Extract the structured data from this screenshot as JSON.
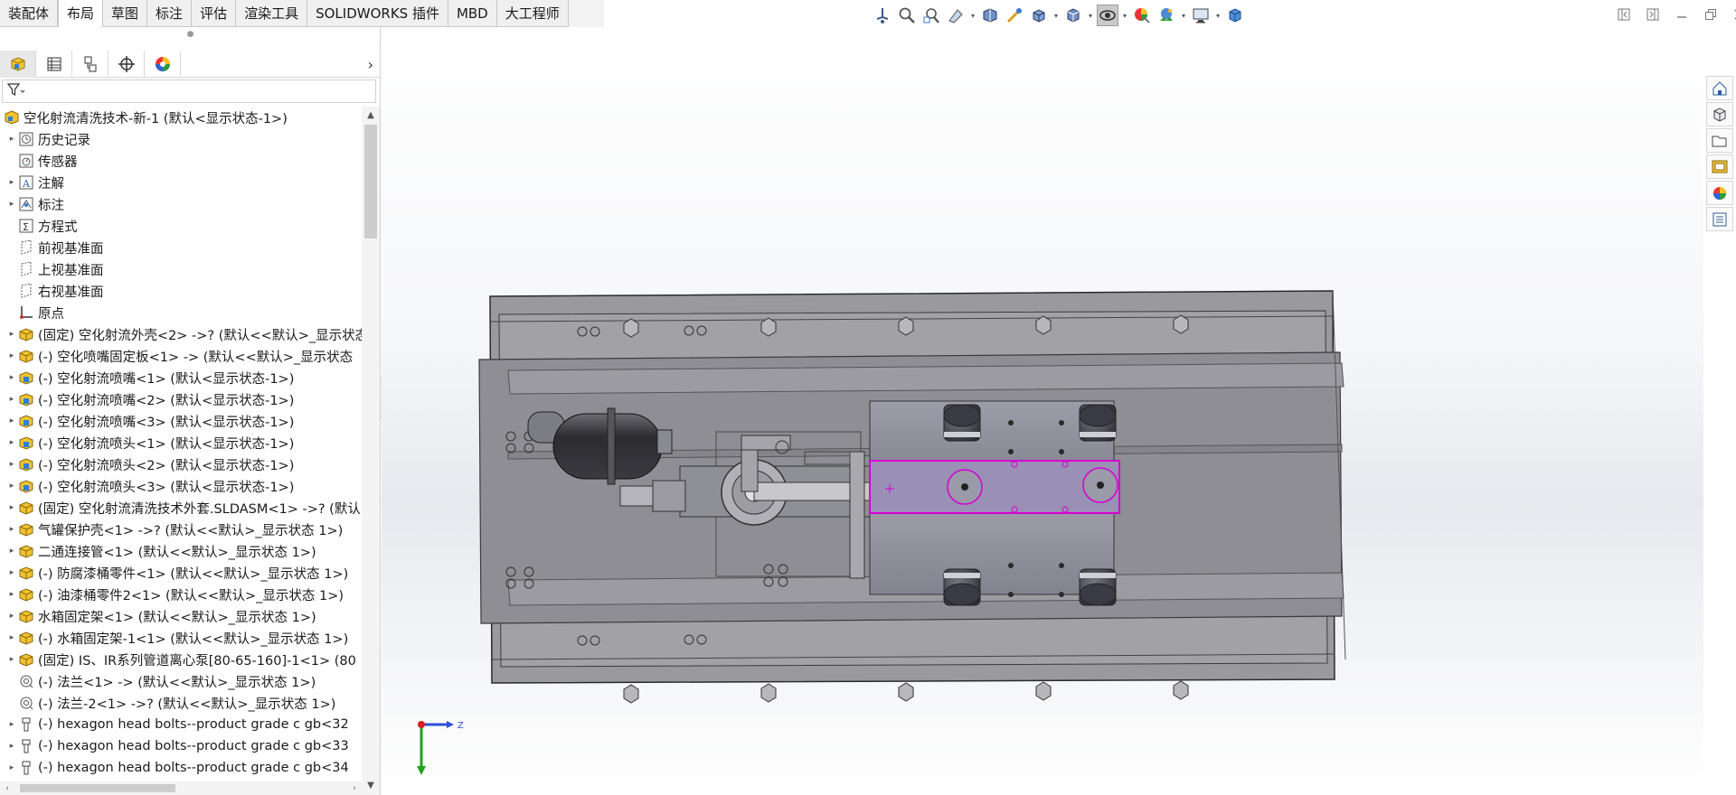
{
  "tabs": [
    {
      "label": "装配体",
      "active": false
    },
    {
      "label": "布局",
      "active": true
    },
    {
      "label": "草图",
      "active": false
    },
    {
      "label": "标注",
      "active": false
    },
    {
      "label": "评估",
      "active": false
    },
    {
      "label": "渲染工具",
      "active": false
    },
    {
      "label": "SOLIDWORKS 插件",
      "active": false
    },
    {
      "label": "MBD",
      "active": false
    },
    {
      "label": "大工程师",
      "active": false
    }
  ],
  "heads_up_toolbar": [
    "view-orientation-icon",
    "zoom-to-fit-icon",
    "zoom-to-area-icon",
    "previous-view-icon",
    "section-view-icon",
    "dynamic-annotation-icon",
    "view-orientation-cube-icon",
    "display-style-icon",
    "hide-show-items-icon",
    "edit-appearance-icon",
    "apply-scene-icon",
    "view-settings-icon",
    "isometric-cube-icon"
  ],
  "feature_manager": {
    "tabs": [
      "feature-manager-icon",
      "property-manager-icon",
      "configuration-manager-icon",
      "dimxpert-icon",
      "display-manager-icon"
    ],
    "tree": [
      {
        "label": "空化射流清洗技术-新-1  (默认<显示状态-1>)",
        "icon": "assembly-icon",
        "expander": false,
        "indent": 0
      },
      {
        "label": "历史记录",
        "icon": "history-icon",
        "expander": true,
        "indent": 1
      },
      {
        "label": "传感器",
        "icon": "sensor-icon",
        "expander": false,
        "indent": 1
      },
      {
        "label": "注解",
        "icon": "annotation-icon",
        "expander": true,
        "indent": 1
      },
      {
        "label": "标注",
        "icon": "markup-icon",
        "expander": true,
        "indent": 1
      },
      {
        "label": "方程式",
        "icon": "equation-icon",
        "expander": false,
        "indent": 1
      },
      {
        "label": "前视基准面",
        "icon": "plane-icon",
        "expander": false,
        "indent": 1
      },
      {
        "label": "上视基准面",
        "icon": "plane-icon",
        "expander": false,
        "indent": 1
      },
      {
        "label": "右视基准面",
        "icon": "plane-icon",
        "expander": false,
        "indent": 1
      },
      {
        "label": "原点",
        "icon": "origin-icon",
        "expander": false,
        "indent": 1
      },
      {
        "label": "(固定) 空化射流外壳<2> ->? (默认<<默认>_显示状态",
        "icon": "subassembly-icon",
        "expander": true,
        "indent": 1
      },
      {
        "label": "(-) 空化喷嘴固定板<1> -> (默认<<默认>_显示状态",
        "icon": "subassembly-icon",
        "expander": true,
        "indent": 1
      },
      {
        "label": "(-) 空化射流喷嘴<1> (默认<显示状态-1>)",
        "icon": "part-icon",
        "expander": true,
        "indent": 1
      },
      {
        "label": "(-) 空化射流喷嘴<2> (默认<显示状态-1>)",
        "icon": "part-icon",
        "expander": true,
        "indent": 1
      },
      {
        "label": "(-) 空化射流喷嘴<3> (默认<显示状态-1>)",
        "icon": "part-icon",
        "expander": true,
        "indent": 1
      },
      {
        "label": "(-) 空化射流喷头<1> (默认<显示状态-1>)",
        "icon": "part-icon",
        "expander": true,
        "indent": 1
      },
      {
        "label": "(-) 空化射流喷头<2> (默认<显示状态-1>)",
        "icon": "part-icon",
        "expander": true,
        "indent": 1
      },
      {
        "label": "(-) 空化射流喷头<3> (默认<显示状态-1>)",
        "icon": "part-icon",
        "expander": true,
        "indent": 1
      },
      {
        "label": "(固定) 空化射流清洗技术外套.SLDASM<1> ->? (默认",
        "icon": "subassembly-icon",
        "expander": true,
        "indent": 1
      },
      {
        "label": "气罐保护壳<1> ->? (默认<<默认>_显示状态 1>)",
        "icon": "subassembly-icon",
        "expander": true,
        "indent": 1
      },
      {
        "label": "二通连接管<1> (默认<<默认>_显示状态 1>)",
        "icon": "subassembly-icon",
        "expander": true,
        "indent": 1
      },
      {
        "label": "(-) 防腐漆桶零件<1> (默认<<默认>_显示状态 1>)",
        "icon": "subassembly-icon",
        "expander": true,
        "indent": 1
      },
      {
        "label": "(-) 油漆桶零件2<1> (默认<<默认>_显示状态 1>)",
        "icon": "subassembly-icon",
        "expander": true,
        "indent": 1
      },
      {
        "label": "水箱固定架<1> (默认<<默认>_显示状态 1>)",
        "icon": "subassembly-icon",
        "expander": true,
        "indent": 1
      },
      {
        "label": "(-) 水箱固定架-1<1> (默认<<默认>_显示状态 1>)",
        "icon": "subassembly-icon",
        "expander": true,
        "indent": 1
      },
      {
        "label": "(固定) IS、IR系列管道离心泵[80-65-160]-1<1> (80",
        "icon": "subassembly-icon",
        "expander": true,
        "indent": 1
      },
      {
        "label": "(-) 法兰<1> -> (默认<<默认>_显示状态 1>)",
        "icon": "flange-icon",
        "expander": false,
        "indent": 1
      },
      {
        "label": "(-) 法兰-2<1> ->? (默认<<默认>_显示状态 1>)",
        "icon": "flange-icon",
        "expander": false,
        "indent": 1
      },
      {
        "label": "(-) hexagon head bolts--product grade c gb<32",
        "icon": "bolt-icon",
        "expander": true,
        "indent": 1
      },
      {
        "label": "(-) hexagon head bolts--product grade c gb<33",
        "icon": "bolt-icon",
        "expander": true,
        "indent": 1
      },
      {
        "label": "(-) hexagon head bolts--product grade c gb<34",
        "icon": "bolt-icon",
        "expander": true,
        "indent": 1
      }
    ]
  },
  "task_pane": [
    "solidworks-resources-icon",
    "design-library-icon",
    "file-explorer-icon",
    "view-palette-icon",
    "appearances-scenes-icon",
    "custom-properties-icon"
  ],
  "triad": {
    "z_label": "Z"
  },
  "colors": {
    "selection": "#d400d4",
    "accent_blue": "#1e6fc8",
    "axis_red": "#d92020",
    "axis_green": "#1fa31f",
    "axis_blue": "#2b4fd8"
  }
}
